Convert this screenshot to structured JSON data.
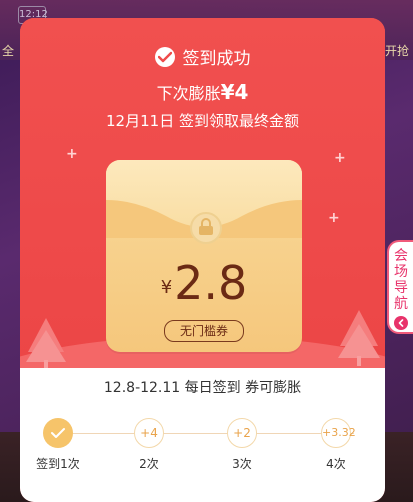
{
  "background": {
    "status_time": "12:12",
    "left_snippet": "全",
    "right_snippet": "开抢"
  },
  "dialog": {
    "success_title": "签到成功",
    "next_inflate_prefix": "下次膨胀",
    "next_inflate_amount": "¥4",
    "claim_date_text": "12月11日 签到领取最终金额",
    "coupon": {
      "currency": "¥",
      "amount": "2.8",
      "tag": "无门槛券"
    },
    "period_text": "12.8-12.11 每日签到 券可膨胀",
    "steps": [
      {
        "value": "",
        "label": "签到1次",
        "done": true
      },
      {
        "value": "+4",
        "label": "2次",
        "done": false
      },
      {
        "value": "+2",
        "label": "3次",
        "done": false
      },
      {
        "value": "+3.32",
        "label": "4次",
        "done": false
      }
    ]
  },
  "side_nav": {
    "label": "会场导航"
  },
  "colors": {
    "dialog_red": "#ef4b4b",
    "envelope_gold": "#f5c77c",
    "amount_brown": "#6b2a14",
    "step_done": "#f6c46a",
    "nav_pink": "#e8336b"
  }
}
